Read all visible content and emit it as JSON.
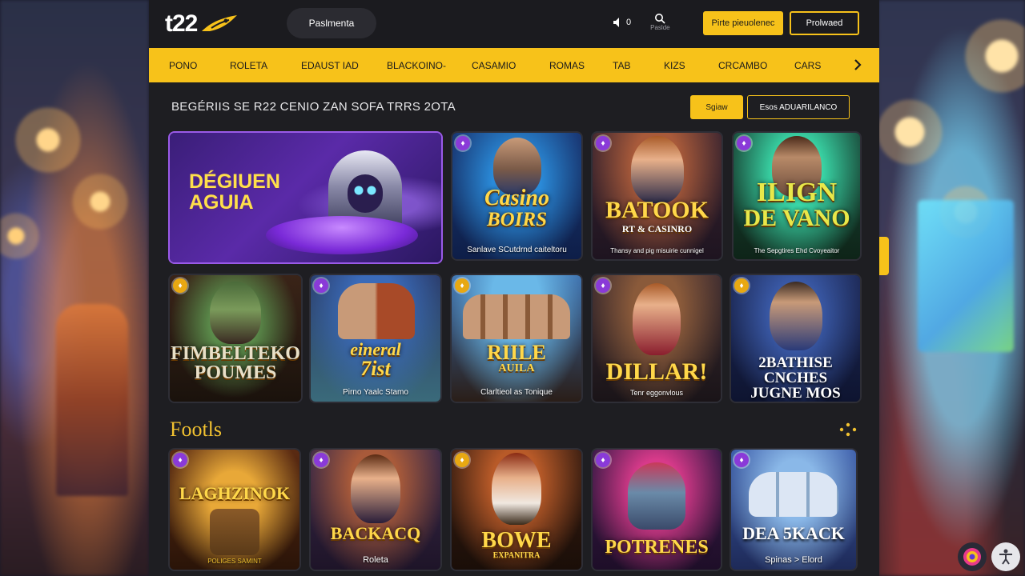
{
  "header": {
    "logo_text": "t22",
    "promo_pill": "Paslmenta",
    "sound_count": "0",
    "search_label": "Paslde",
    "btn_primary": "Pirte pieuolenec",
    "btn_secondary": "Prolwaed"
  },
  "nav": {
    "items": [
      "PONO",
      "ROLETA",
      "EDAUST IAD",
      "BLACKOINO-",
      "CASAMIO",
      "ROMAS",
      "TAB",
      "KIZS",
      "CRCAMBO",
      "CARS"
    ]
  },
  "section1": {
    "title": "BEGÉRIIS SE R22 CENIO ZAN SOFA TRRS 2OTA",
    "btn_small": "Sgiaw",
    "btn_outline": "Esos ADUARILANCO"
  },
  "featured": {
    "title_line1": "DÉGIUEN",
    "title_line2": "AGUIA"
  },
  "row1": [
    {
      "title1": "Casino",
      "title2": "BOIRS",
      "sub": "Sanlave SCutdrnd caiteltoru"
    },
    {
      "title1": "BATOOK",
      "title2": "RT & CASINRO",
      "sub": "Thansy and pig misuirie cunnigel"
    },
    {
      "title1": "ILIGN",
      "title2": "DE VANO",
      "sub": "The Sepgtires Ehd Cvoyeaitor"
    }
  ],
  "row2": [
    {
      "title1": "FIMBELTEKO",
      "title2": "POUMES",
      "sub": ""
    },
    {
      "title1": "eineral",
      "title2": "7ist",
      "sub": "Pirno Yaalc Stamo"
    },
    {
      "title1": "RIILE",
      "title2": "AUILA",
      "sub": "Clarltieol as Tonique"
    },
    {
      "title1": "DILLAR!",
      "title2": "",
      "sub": "Tenr eggonvlous"
    },
    {
      "title1": "2BATHISE",
      "title2": "CNCHES",
      "title3": "JUGNE MOS",
      "sub": ""
    }
  ],
  "section2": {
    "title": "Footls"
  },
  "row3": [
    {
      "title1": "LAGHZINOK",
      "sub": "POLIGES SAMINT"
    },
    {
      "title1": "BACKACQ",
      "sub": "Roleta"
    },
    {
      "title1": "BOWE",
      "title2": "EXPANITRA",
      "sub": ""
    },
    {
      "title1": "POTRENES",
      "sub": ""
    },
    {
      "title1": "DEA 5KACK",
      "sub": "Spinas > Elord"
    }
  ],
  "colors": {
    "accent": "#f7c21a",
    "panel": "#1e1e22",
    "purple": "#8a3ad8"
  }
}
